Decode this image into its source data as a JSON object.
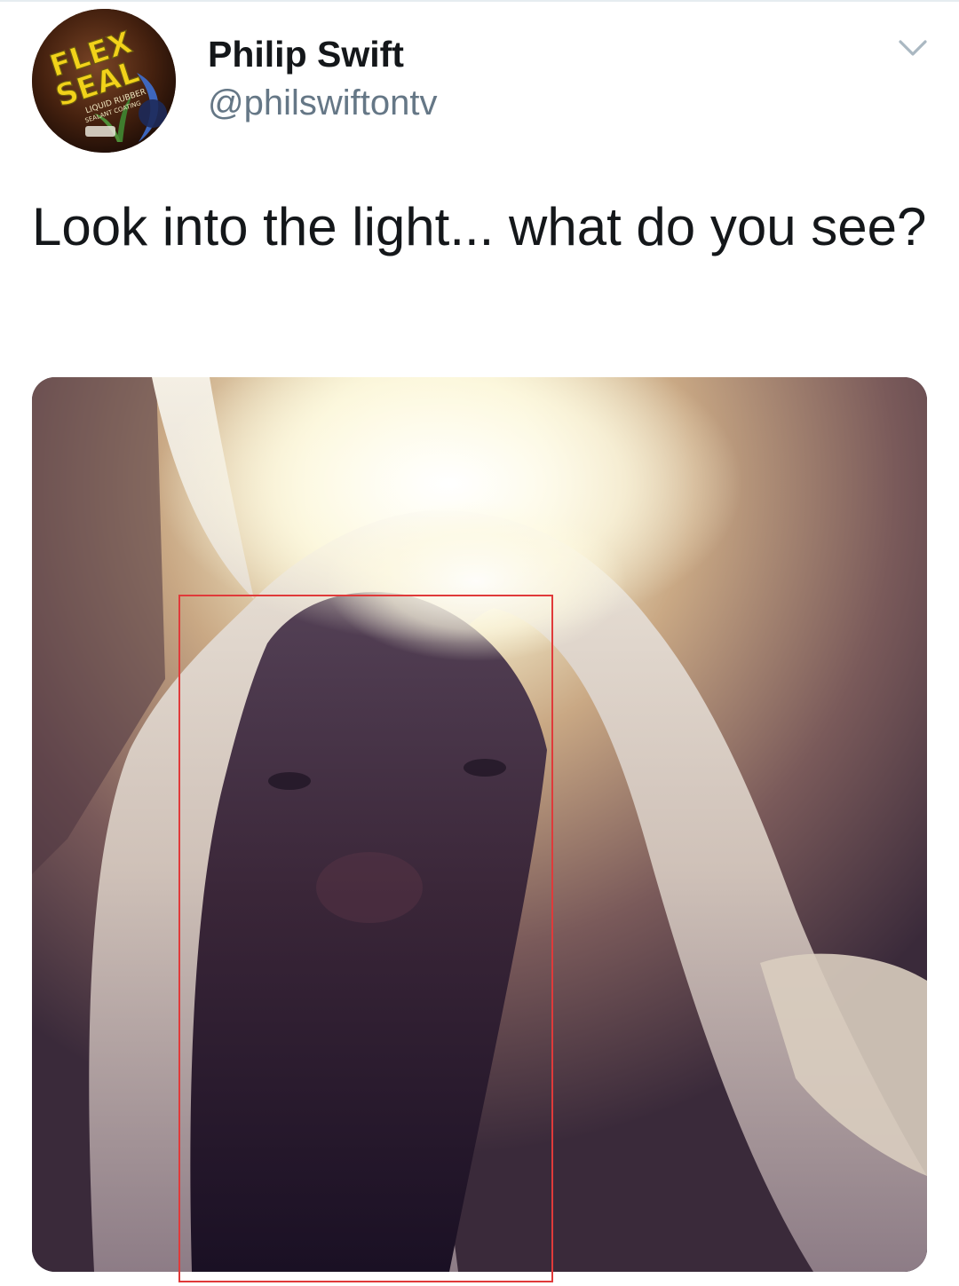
{
  "tweet": {
    "author": {
      "display_name": "Philip Swift",
      "handle": "@philswiftontv",
      "avatar": {
        "kind": "logo",
        "logo_text_line1": "FLEX",
        "logo_text_line2": "SEAL",
        "logo_subtext_1": "LIQUID RUBBER",
        "logo_subtext_2": "SEALANT COATING"
      }
    },
    "text": "Look into the light... what do you see?",
    "more_icon": "chevron-down-icon",
    "media": {
      "kind": "photo",
      "highlight_color": "#e03a3a"
    }
  },
  "colors": {
    "text_primary": "#14171a",
    "text_secondary": "#657786",
    "divider": "#e6ecf0",
    "logo_yellow": "#f2d21a"
  }
}
